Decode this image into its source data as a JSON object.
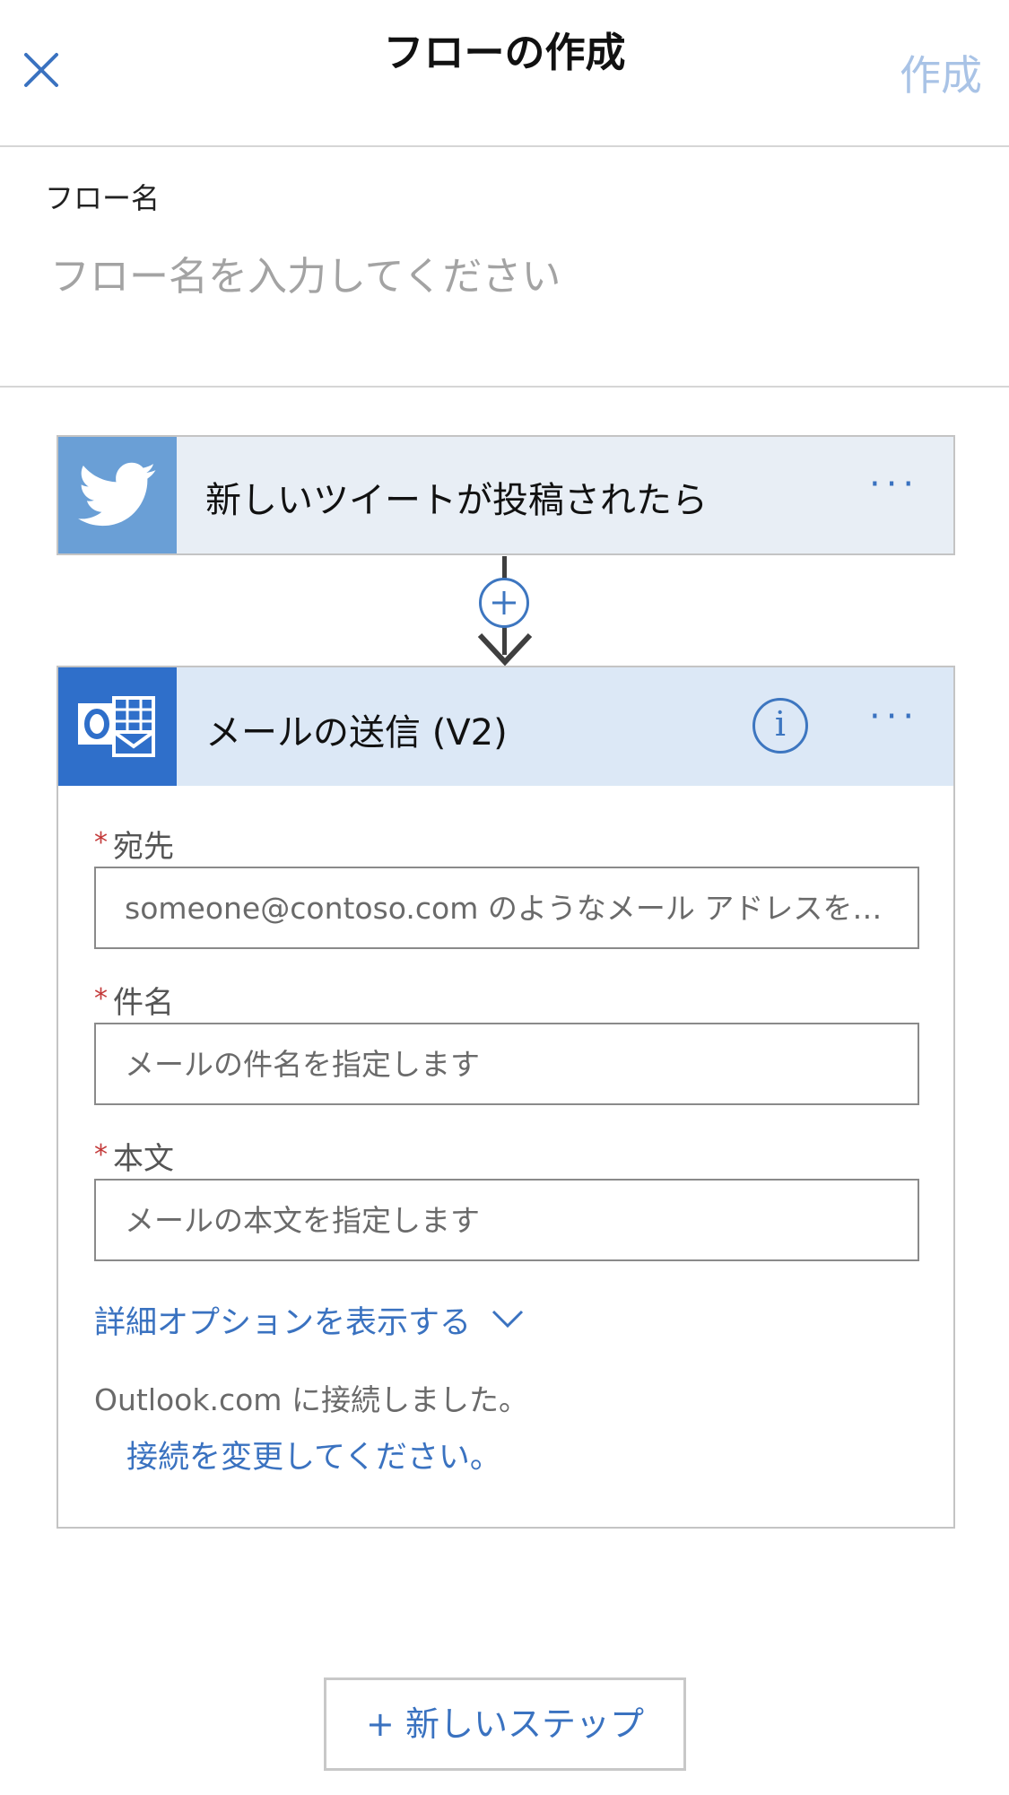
{
  "header": {
    "title": "フローの作成",
    "create_label": "作成"
  },
  "flow_name": {
    "label": "フロー名",
    "placeholder": "フロー名を入力してください"
  },
  "trigger": {
    "title": "新しいツイートが投稿されたら",
    "icon": "twitter-bird-icon",
    "more": "···"
  },
  "action": {
    "title": "メールの送信 (V2)",
    "icon": "outlook-icon",
    "info": "i",
    "more": "···",
    "fields": [
      {
        "required_mark": "*",
        "label": "宛先",
        "placeholder": "someone@contoso.com のようなメール アドレスを…"
      },
      {
        "required_mark": "*",
        "label": "件名",
        "placeholder": "メールの件名を指定します"
      },
      {
        "required_mark": "*",
        "label": "本文",
        "placeholder": "メールの本文を指定します"
      }
    ],
    "advanced_label": "詳細オプションを表示する",
    "connected_text": "Outlook.com に接続しました。",
    "change_connection_label": "接続を変更してください。"
  },
  "new_step_label": "+ 新しいステップ",
  "colors": {
    "accent": "#3a72c0",
    "create_disabled": "#a9c3e6",
    "twitter_tile": "#6a9fd6",
    "outlook_tile": "#2f6fca",
    "required": "#c43a3a"
  }
}
